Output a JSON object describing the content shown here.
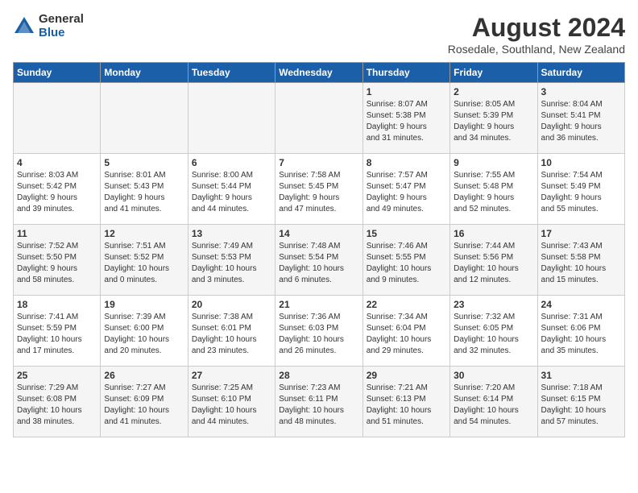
{
  "logo": {
    "general": "General",
    "blue": "Blue"
  },
  "title": "August 2024",
  "subtitle": "Rosedale, Southland, New Zealand",
  "weekdays": [
    "Sunday",
    "Monday",
    "Tuesday",
    "Wednesday",
    "Thursday",
    "Friday",
    "Saturday"
  ],
  "weeks": [
    [
      {
        "day": "",
        "info": ""
      },
      {
        "day": "",
        "info": ""
      },
      {
        "day": "",
        "info": ""
      },
      {
        "day": "",
        "info": ""
      },
      {
        "day": "1",
        "info": "Sunrise: 8:07 AM\nSunset: 5:38 PM\nDaylight: 9 hours\nand 31 minutes."
      },
      {
        "day": "2",
        "info": "Sunrise: 8:05 AM\nSunset: 5:39 PM\nDaylight: 9 hours\nand 34 minutes."
      },
      {
        "day": "3",
        "info": "Sunrise: 8:04 AM\nSunset: 5:41 PM\nDaylight: 9 hours\nand 36 minutes."
      }
    ],
    [
      {
        "day": "4",
        "info": "Sunrise: 8:03 AM\nSunset: 5:42 PM\nDaylight: 9 hours\nand 39 minutes."
      },
      {
        "day": "5",
        "info": "Sunrise: 8:01 AM\nSunset: 5:43 PM\nDaylight: 9 hours\nand 41 minutes."
      },
      {
        "day": "6",
        "info": "Sunrise: 8:00 AM\nSunset: 5:44 PM\nDaylight: 9 hours\nand 44 minutes."
      },
      {
        "day": "7",
        "info": "Sunrise: 7:58 AM\nSunset: 5:45 PM\nDaylight: 9 hours\nand 47 minutes."
      },
      {
        "day": "8",
        "info": "Sunrise: 7:57 AM\nSunset: 5:47 PM\nDaylight: 9 hours\nand 49 minutes."
      },
      {
        "day": "9",
        "info": "Sunrise: 7:55 AM\nSunset: 5:48 PM\nDaylight: 9 hours\nand 52 minutes."
      },
      {
        "day": "10",
        "info": "Sunrise: 7:54 AM\nSunset: 5:49 PM\nDaylight: 9 hours\nand 55 minutes."
      }
    ],
    [
      {
        "day": "11",
        "info": "Sunrise: 7:52 AM\nSunset: 5:50 PM\nDaylight: 9 hours\nand 58 minutes."
      },
      {
        "day": "12",
        "info": "Sunrise: 7:51 AM\nSunset: 5:52 PM\nDaylight: 10 hours\nand 0 minutes."
      },
      {
        "day": "13",
        "info": "Sunrise: 7:49 AM\nSunset: 5:53 PM\nDaylight: 10 hours\nand 3 minutes."
      },
      {
        "day": "14",
        "info": "Sunrise: 7:48 AM\nSunset: 5:54 PM\nDaylight: 10 hours\nand 6 minutes."
      },
      {
        "day": "15",
        "info": "Sunrise: 7:46 AM\nSunset: 5:55 PM\nDaylight: 10 hours\nand 9 minutes."
      },
      {
        "day": "16",
        "info": "Sunrise: 7:44 AM\nSunset: 5:56 PM\nDaylight: 10 hours\nand 12 minutes."
      },
      {
        "day": "17",
        "info": "Sunrise: 7:43 AM\nSunset: 5:58 PM\nDaylight: 10 hours\nand 15 minutes."
      }
    ],
    [
      {
        "day": "18",
        "info": "Sunrise: 7:41 AM\nSunset: 5:59 PM\nDaylight: 10 hours\nand 17 minutes."
      },
      {
        "day": "19",
        "info": "Sunrise: 7:39 AM\nSunset: 6:00 PM\nDaylight: 10 hours\nand 20 minutes."
      },
      {
        "day": "20",
        "info": "Sunrise: 7:38 AM\nSunset: 6:01 PM\nDaylight: 10 hours\nand 23 minutes."
      },
      {
        "day": "21",
        "info": "Sunrise: 7:36 AM\nSunset: 6:03 PM\nDaylight: 10 hours\nand 26 minutes."
      },
      {
        "day": "22",
        "info": "Sunrise: 7:34 AM\nSunset: 6:04 PM\nDaylight: 10 hours\nand 29 minutes."
      },
      {
        "day": "23",
        "info": "Sunrise: 7:32 AM\nSunset: 6:05 PM\nDaylight: 10 hours\nand 32 minutes."
      },
      {
        "day": "24",
        "info": "Sunrise: 7:31 AM\nSunset: 6:06 PM\nDaylight: 10 hours\nand 35 minutes."
      }
    ],
    [
      {
        "day": "25",
        "info": "Sunrise: 7:29 AM\nSunset: 6:08 PM\nDaylight: 10 hours\nand 38 minutes."
      },
      {
        "day": "26",
        "info": "Sunrise: 7:27 AM\nSunset: 6:09 PM\nDaylight: 10 hours\nand 41 minutes."
      },
      {
        "day": "27",
        "info": "Sunrise: 7:25 AM\nSunset: 6:10 PM\nDaylight: 10 hours\nand 44 minutes."
      },
      {
        "day": "28",
        "info": "Sunrise: 7:23 AM\nSunset: 6:11 PM\nDaylight: 10 hours\nand 48 minutes."
      },
      {
        "day": "29",
        "info": "Sunrise: 7:21 AM\nSunset: 6:13 PM\nDaylight: 10 hours\nand 51 minutes."
      },
      {
        "day": "30",
        "info": "Sunrise: 7:20 AM\nSunset: 6:14 PM\nDaylight: 10 hours\nand 54 minutes."
      },
      {
        "day": "31",
        "info": "Sunrise: 7:18 AM\nSunset: 6:15 PM\nDaylight: 10 hours\nand 57 minutes."
      }
    ]
  ]
}
